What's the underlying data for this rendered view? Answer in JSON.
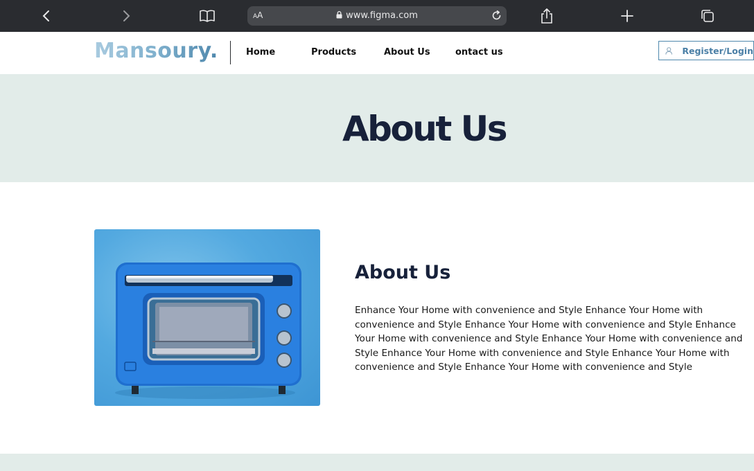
{
  "browser": {
    "url": "www.figma.com",
    "reader_label": "AA",
    "icons": [
      "back-icon",
      "forward-icon",
      "bookmarks-icon",
      "lock-icon",
      "reload-icon",
      "share-icon",
      "new-tab-icon",
      "tabs-icon"
    ]
  },
  "nav": {
    "logo": "Mansoury.",
    "links": [
      "Home",
      "Products",
      "About Us",
      "ontact us"
    ],
    "register_label": "Register/Login"
  },
  "hero": {
    "title": "About Us"
  },
  "about": {
    "heading": "About Us",
    "body": "Enhance Your Home with convenience and Style Enhance Your Home with convenience and Style Enhance Your Home with convenience and Style Enhance Your Home with convenience and Style Enhance Your Home with convenience and Style Enhance Your Home with convenience and Style Enhance Your Home with convenience and Style Enhance Your Home with convenience and Style"
  },
  "colors": {
    "hero_bg": "#e2ece9",
    "heading": "#17213a",
    "accent": "#4f88ad",
    "browser_bar": "#2a2c30"
  }
}
